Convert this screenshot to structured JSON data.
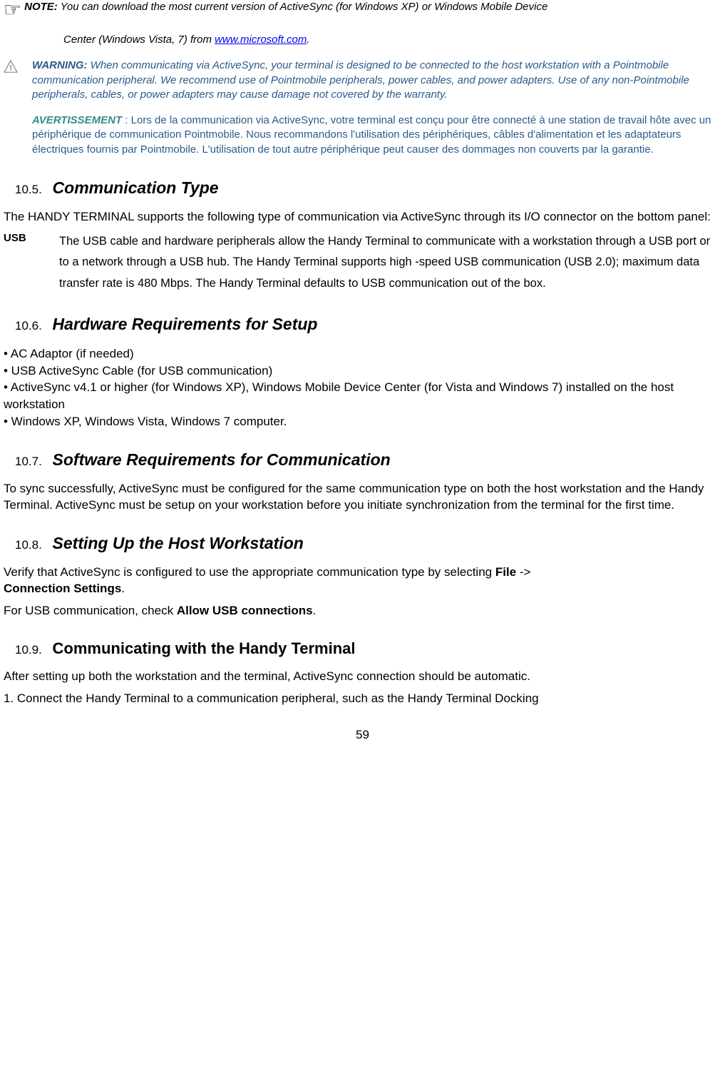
{
  "note": {
    "label": "NOTE:",
    "text1": " You can download the most current version of ActiveSync (for Windows XP) or Windows Mobile Device",
    "text2": "Center (Windows Vista, 7) from ",
    "link": "www.microsoft.com",
    "text3": "."
  },
  "warning": {
    "label": "WARNING:",
    "text": " When communicating via ActiveSync, your terminal is designed to be connected to the host workstation with a Pointmobile communication peripheral. We recommend use of Pointmobile peripherals, power cables, and power adapters. Use of any non-Pointmobile peripherals, cables, or power adapters may cause damage not covered by the warranty."
  },
  "avert": {
    "label": "AVERTISSEMENT",
    "text": " : Lors de la communication via ActiveSync, votre terminal est conçu pour être connecté à une station de travail hôte avec un périphérique de communication Pointmobile. Nous recommandons l'utilisation des périphériques, câbles d'alimentation et les adaptateurs électriques fournis par Pointmobile. L'utilisation de tout autre périphérique peut causer des dommages non couverts par la garantie."
  },
  "s105": {
    "num": "10.5.",
    "title": "Communication Type",
    "p1": "The HANDY TERMINAL supports the following type of communication via ActiveSync through its I/O connector on the bottom panel:",
    "usb_label": "USB",
    "usb_desc": "The USB cable and hardware peripherals allow the Handy Terminal to communicate with a workstation through a USB port or to a network through a USB hub. The Handy Terminal supports high -speed USB communication (USB 2.0); maximum data transfer rate is 480 Mbps. The Handy Terminal defaults to USB communication out of the box."
  },
  "s106": {
    "num": "10.6.",
    "title": "Hardware Requirements for Setup",
    "b1": "• AC Adaptor (if needed)",
    "b2": "• USB ActiveSync Cable (for USB communication)",
    "b3": "• ActiveSync v4.1 or higher (for Windows XP), Windows Mobile Device Center (for Vista and Windows 7) installed on the host workstation",
    "b4": "• Windows XP, Windows Vista, Windows 7 computer."
  },
  "s107": {
    "num": "10.7.",
    "title": "Software Requirements for Communication",
    "p1": "To sync successfully, ActiveSync must be configured for the same communication type on both the host workstation and the Handy Terminal. ActiveSync must be setup on your workstation before you initiate synchronization from the terminal for the first time."
  },
  "s108": {
    "num": "10.8.",
    "title": "Setting Up the Host Workstation",
    "p1a": "Verify that ActiveSync is configured to use the appropriate communication type by selecting ",
    "p1b": "File",
    "p1c": " -> ",
    "p1d": "Connection Settings",
    "p1e": ".",
    "p2a": "For USB communication, check ",
    "p2b": "Allow USB connections",
    "p2c": "."
  },
  "s109": {
    "num": "10.9.",
    "title": "Communicating with the Handy Terminal",
    "p1": "After setting up both the workstation and the terminal, ActiveSync connection should be automatic.",
    "p2": "1. Connect the Handy Terminal to a communication peripheral, such as the Handy Terminal Docking"
  },
  "page_num": "59"
}
